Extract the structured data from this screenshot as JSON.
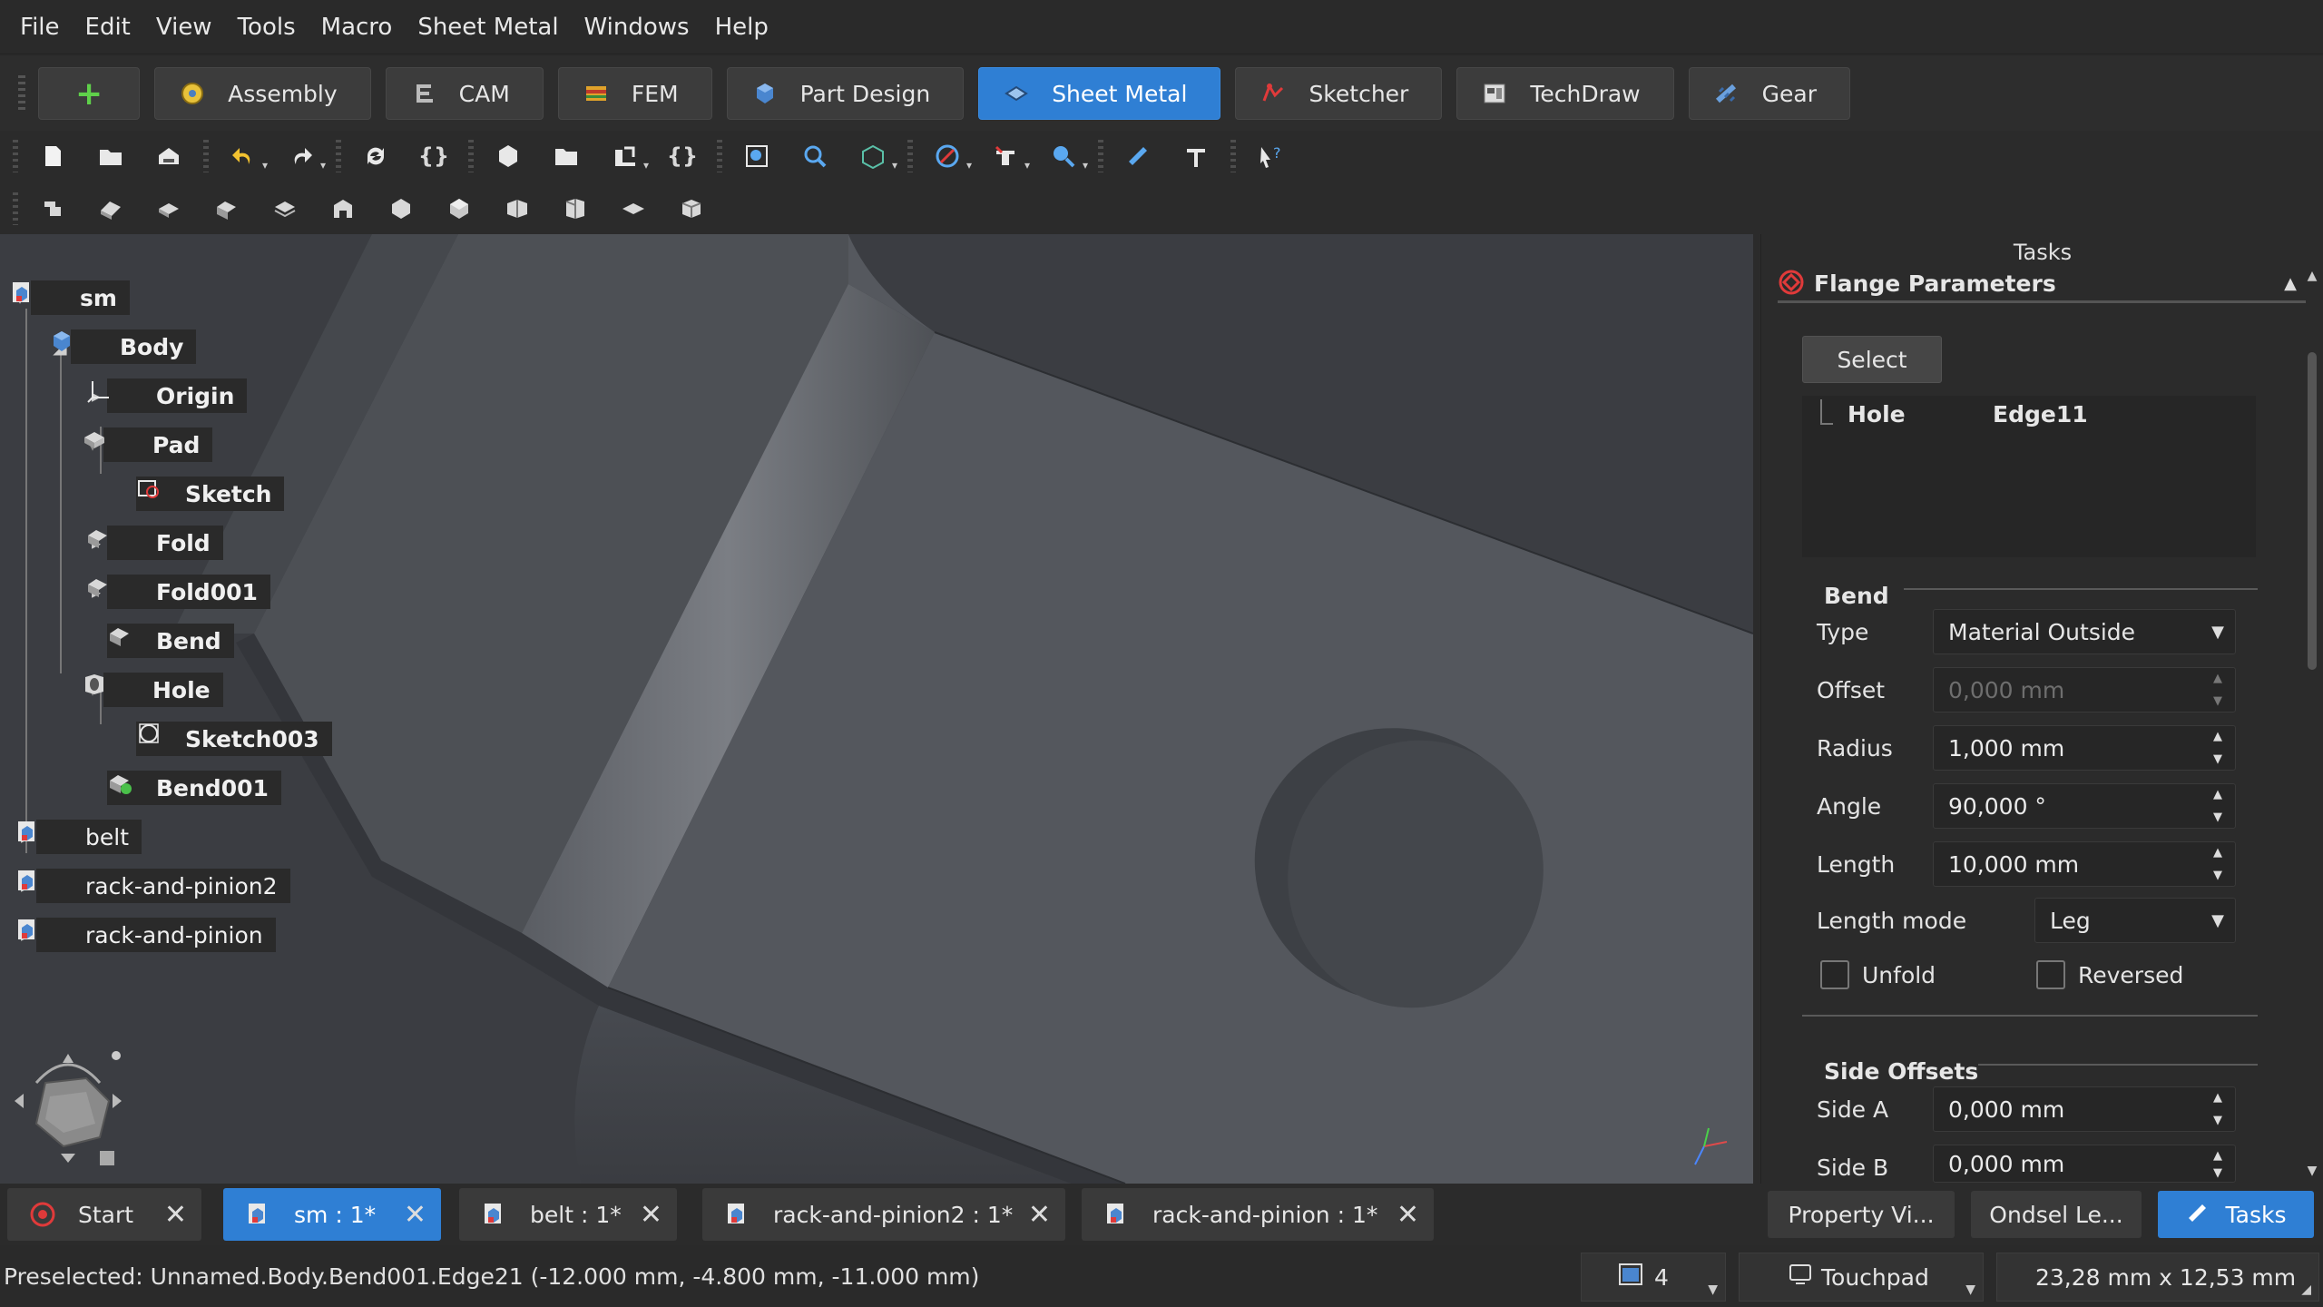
{
  "menu": [
    "File",
    "Edit",
    "View",
    "Tools",
    "Macro",
    "Sheet Metal",
    "Windows",
    "Help"
  ],
  "workbenches": [
    {
      "label": "Assembly"
    },
    {
      "label": "CAM"
    },
    {
      "label": "FEM"
    },
    {
      "label": "Part Design"
    },
    {
      "label": "Sheet Metal",
      "active": true
    },
    {
      "label": "Sketcher"
    },
    {
      "label": "TechDraw"
    },
    {
      "label": "Gear"
    }
  ],
  "tree": {
    "sm": "sm",
    "body": "Body",
    "origin": "Origin",
    "pad": "Pad",
    "sketch": "Sketch",
    "fold": "Fold",
    "fold001": "Fold001",
    "bend": "Bend",
    "hole": "Hole",
    "sketch003": "Sketch003",
    "bend001": "Bend001",
    "belt": "belt",
    "rack_and_pinion2": "rack-and-pinion2",
    "rack_and_pinion": "rack-and-pinion"
  },
  "tasks": {
    "title": "Tasks",
    "panel_title": "Flange Parameters",
    "select_label": "Select",
    "ref_object": "Hole",
    "ref_subelement": "Edge11",
    "bend_group": "Bend",
    "type_label": "Type",
    "type_value": "Material Outside",
    "offset_label": "Offset",
    "offset_value": "0,000 mm",
    "radius_label": "Radius",
    "radius_value": "1,000 mm",
    "angle_label": "Angle",
    "angle_value": "90,000 °",
    "length_label": "Length",
    "length_value": "10,000 mm",
    "length_mode_label": "Length mode",
    "length_mode_value": "Leg",
    "unfold_label": "Unfold",
    "reversed_label": "Reversed",
    "side_offsets_group": "Side Offsets",
    "side_a_label": "Side A",
    "side_a_value": "0,000 mm",
    "side_b_label": "Side B",
    "side_b_value": "0,000 mm"
  },
  "doc_tabs": [
    {
      "label": "Start"
    },
    {
      "label": "sm : 1*",
      "active": true
    },
    {
      "label": "belt : 1*"
    },
    {
      "label": "rack-and-pinion2 : 1*"
    },
    {
      "label": "rack-and-pinion : 1*"
    }
  ],
  "panel_tabs": {
    "property_view": "Property Vi...",
    "selection_view": "Ondsel Le...",
    "tasks": "Tasks"
  },
  "status": {
    "message": "Preselected: Unnamed.Body.Bend001.Edge21 (-12.000 mm, -4.800 mm, -11.000 mm)",
    "views_count": "4",
    "nav_style": "Touchpad",
    "dimensions": "23,28 mm x 12,53 mm"
  },
  "colors": {
    "accent": "#2f7fd4",
    "background": "#2b2b2b",
    "viewport": "#3b3d42"
  }
}
